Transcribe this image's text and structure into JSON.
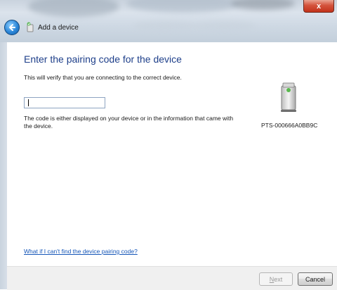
{
  "window": {
    "title": "Add a device",
    "close_glyph": "x"
  },
  "main": {
    "heading": "Enter the pairing code for the device",
    "subtext": "This will verify that you are connecting to the correct device.",
    "code_input": {
      "value": "",
      "placeholder": ""
    },
    "hint": "The code is either displayed on your device or in the information that came with the device.",
    "device_name": "PTS-000666A0BB9C",
    "help_link": "What if I can't find the device pairing code?"
  },
  "footer": {
    "next_label_accel": "N",
    "next_label_rest": "ext",
    "cancel_label": "Cancel"
  },
  "icons": {
    "back": "back-arrow-icon",
    "wizard": "bluetooth-device-icon",
    "device": "printer-device-icon"
  },
  "colors": {
    "heading": "#1e3f8a",
    "link": "#1556b8",
    "close": "#c2321b"
  }
}
